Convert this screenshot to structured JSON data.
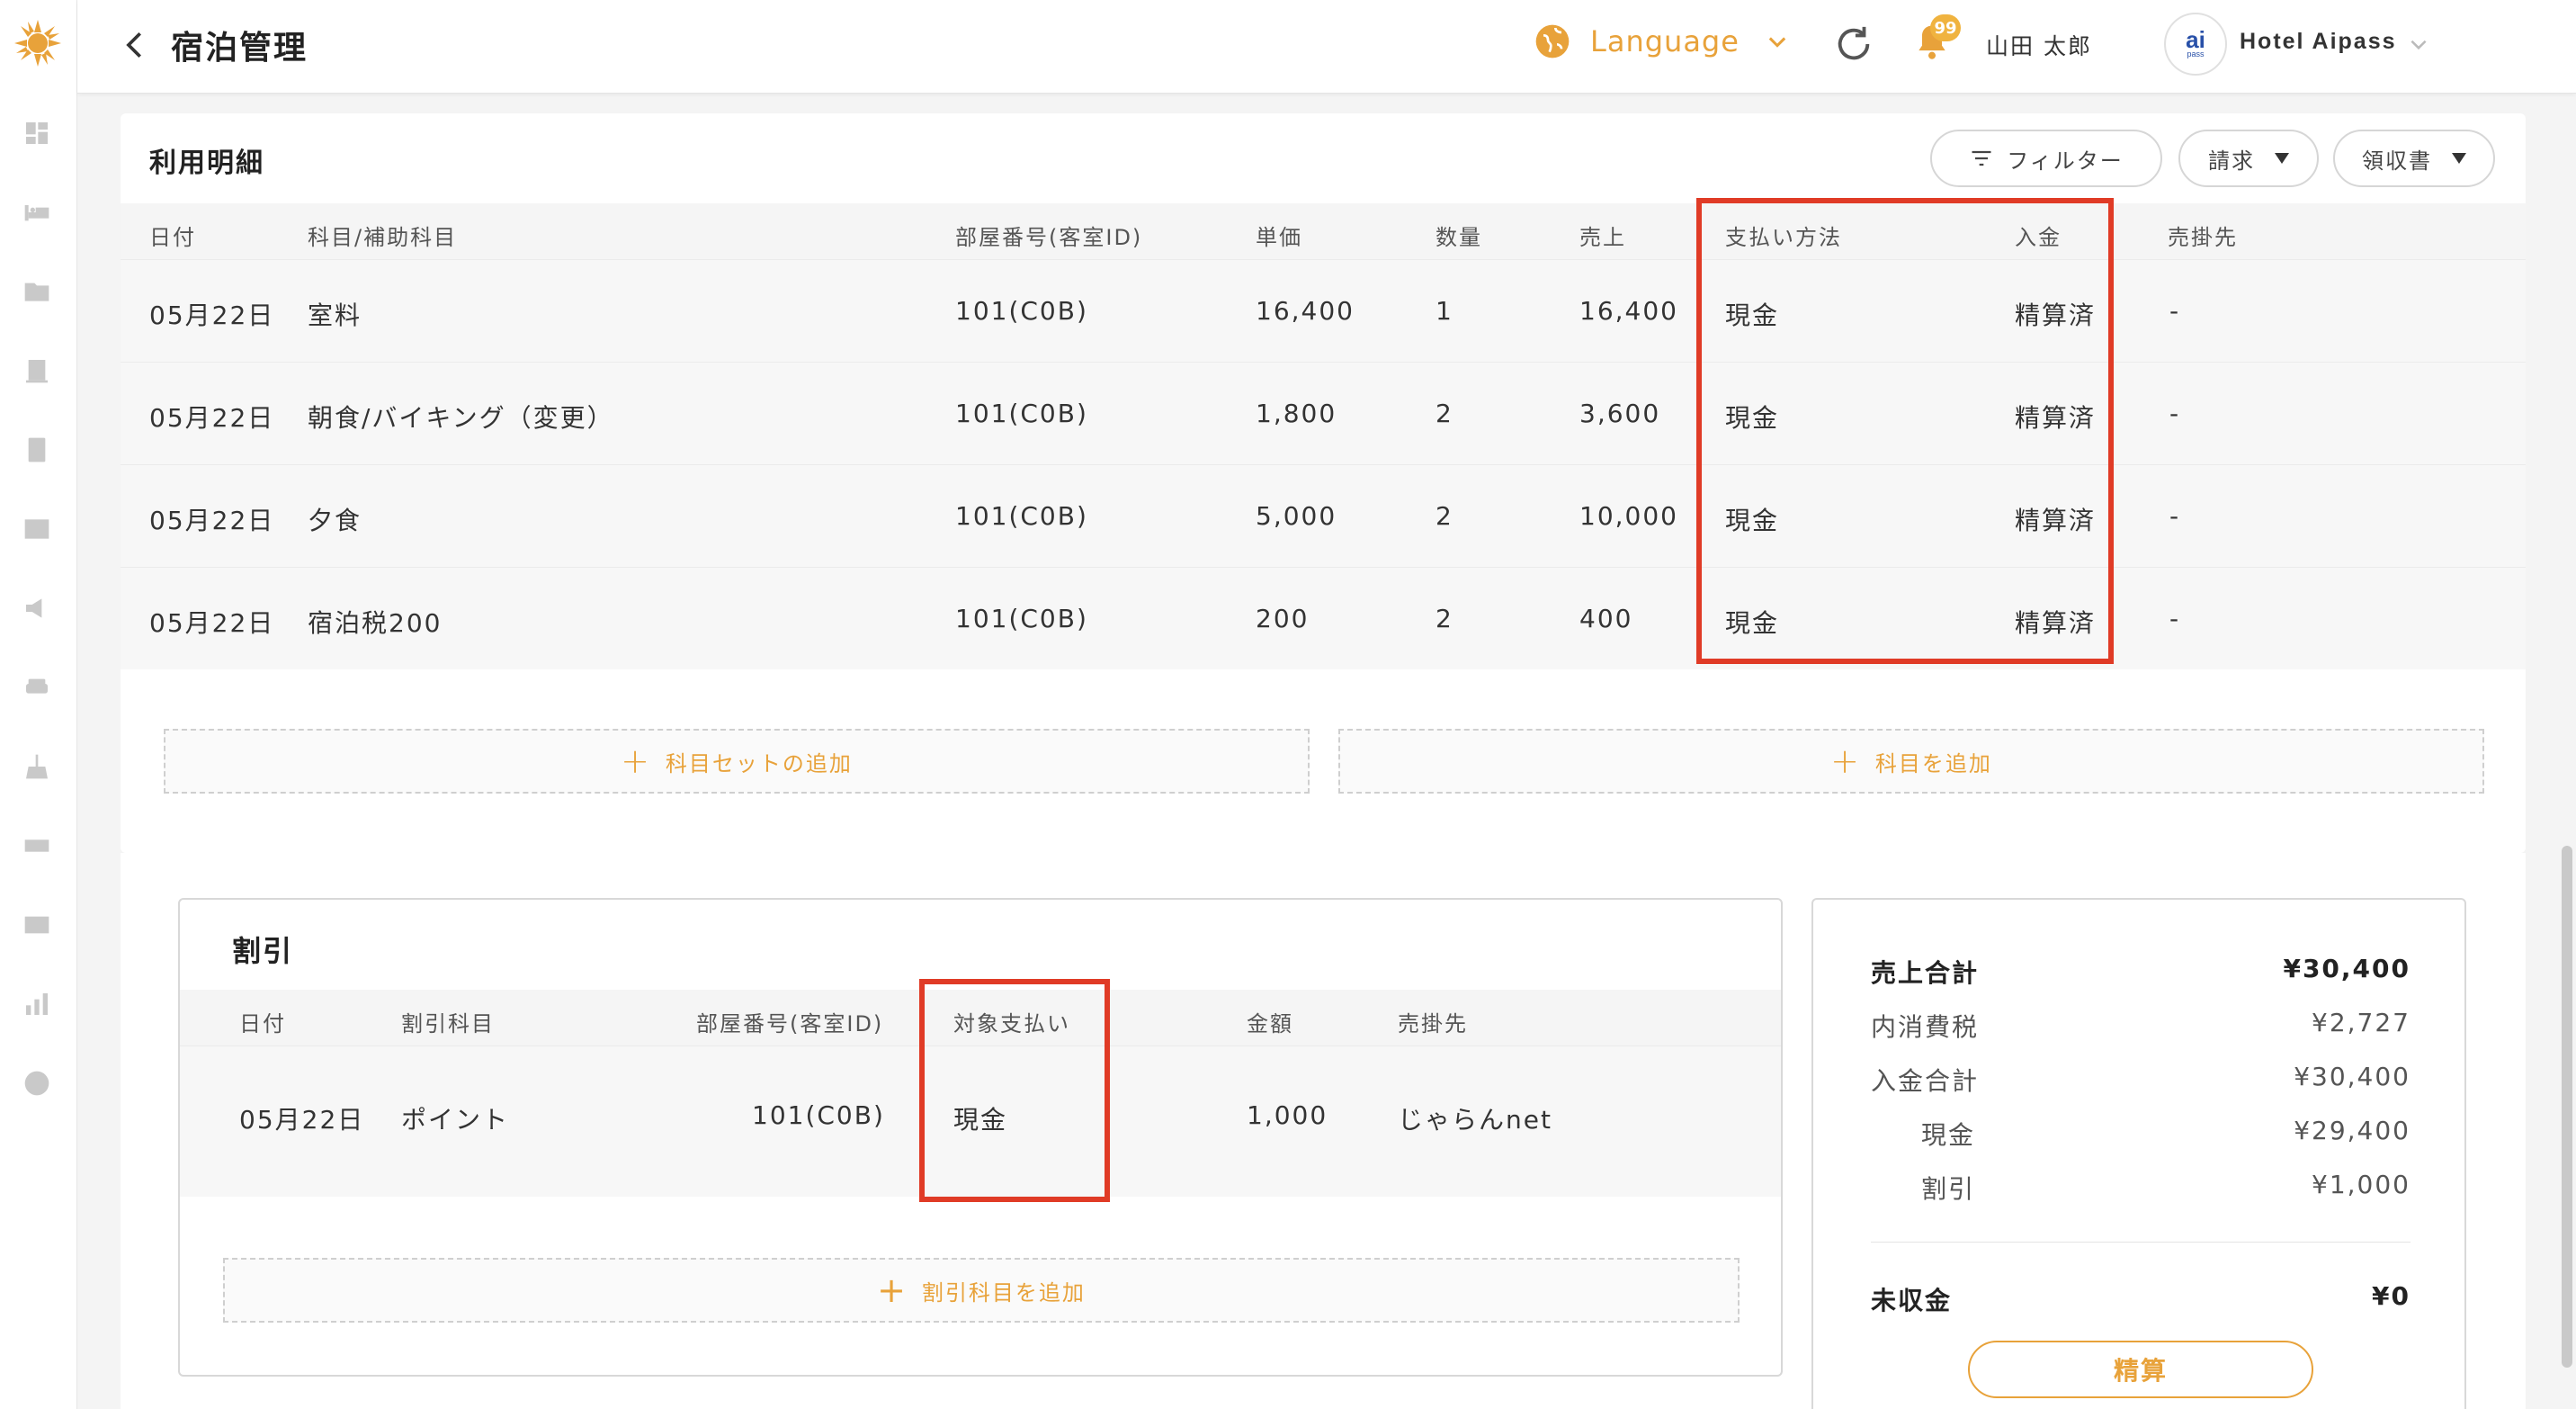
{
  "header": {
    "title": "宿泊管理",
    "language_label": "Language",
    "notification_count": "99",
    "user_name": "山田 太郎",
    "hotel_name": "Hotel Aipass",
    "hotel_logo_text": "ai",
    "hotel_logo_subtext": "pass"
  },
  "usage": {
    "title": "利用明細",
    "filter_label": "フィルター",
    "invoice_label": "請求",
    "receipt_label": "領収書",
    "columns": [
      "日付",
      "科目/補助科目",
      "部屋番号(客室ID)",
      "単価",
      "数量",
      "売上",
      "支払い方法",
      "入金",
      "売掛先"
    ],
    "rows": [
      {
        "date": "05月22日",
        "item": "室料",
        "room": "101(C0B)",
        "unit_price": "16,400",
        "qty": "1",
        "sales": "16,400",
        "payment": "現金",
        "deposit": "精算済",
        "receivable": "-"
      },
      {
        "date": "05月22日",
        "item": "朝食/バイキング（変更）",
        "room": "101(C0B)",
        "unit_price": "1,800",
        "qty": "2",
        "sales": "3,600",
        "payment": "現金",
        "deposit": "精算済",
        "receivable": "-"
      },
      {
        "date": "05月22日",
        "item": "夕食",
        "room": "101(C0B)",
        "unit_price": "5,000",
        "qty": "2",
        "sales": "10,000",
        "payment": "現金",
        "deposit": "精算済",
        "receivable": "-"
      },
      {
        "date": "05月22日",
        "item": "宿泊税200",
        "room": "101(C0B)",
        "unit_price": "200",
        "qty": "2",
        "sales": "400",
        "payment": "現金",
        "deposit": "精算済",
        "receivable": "-"
      }
    ],
    "add_set_label": "科目セットの追加",
    "add_item_label": "科目を追加"
  },
  "discount": {
    "title": "割引",
    "columns": [
      "日付",
      "割引科目",
      "部屋番号(客室ID)",
      "対象支払い",
      "金額",
      "売掛先"
    ],
    "rows": [
      {
        "date": "05月22日",
        "item": "ポイント",
        "room": "101(C0B)",
        "target_payment": "現金",
        "amount": "1,000",
        "receivable": "じゃらんnet"
      }
    ],
    "add_label": "割引科目を追加"
  },
  "summary": {
    "sales_total_label": "売上合計",
    "sales_total": "¥30,400",
    "tax_label": "内消費税",
    "tax": "¥2,727",
    "deposit_total_label": "入金合計",
    "deposit_total": "¥30,400",
    "cash_label": "現金",
    "cash": "¥29,400",
    "discount_label": "割引",
    "discount": "¥1,000",
    "unpaid_label": "未収金",
    "unpaid": "¥0",
    "settle_label": "精算"
  },
  "colors": {
    "accent": "#e8a23a",
    "highlight": "#e03b26",
    "logo_blue": "#2850a8"
  }
}
